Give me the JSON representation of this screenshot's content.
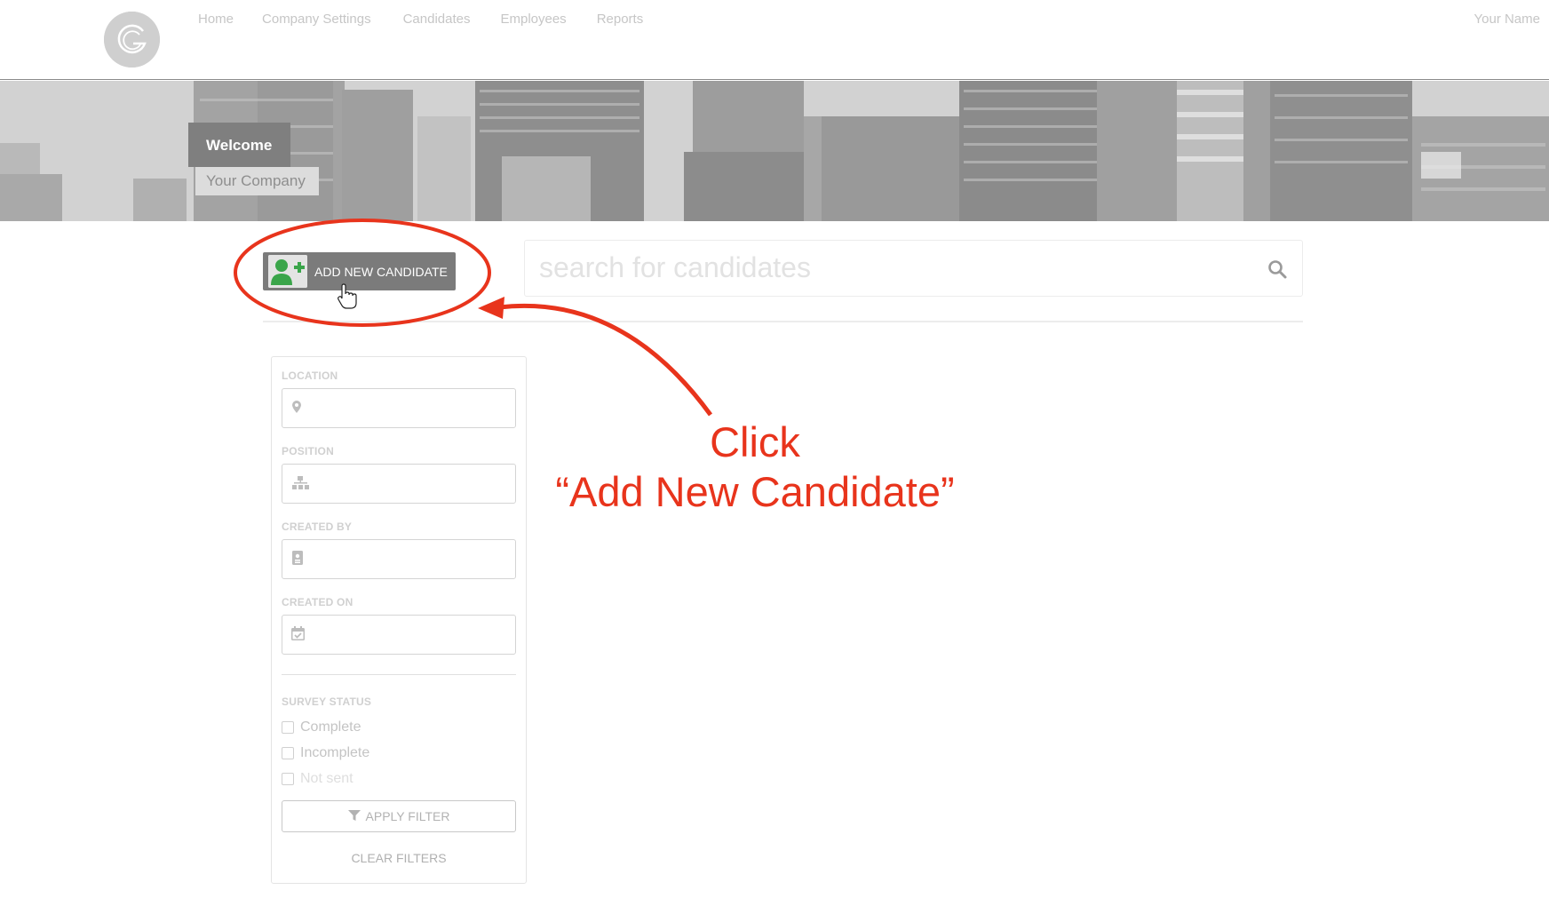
{
  "nav": {
    "items": [
      "Home",
      "Company Settings",
      "Candidates",
      "Employees",
      "Reports"
    ],
    "user_name": "Your Name"
  },
  "banner": {
    "welcome": "Welcome",
    "company": "Your Company"
  },
  "actions": {
    "add_candidate_label": "ADD NEW CANDIDATE",
    "search_placeholder": "search for candidates"
  },
  "filters": {
    "location_label": "LOCATION",
    "position_label": "POSITION",
    "created_by_label": "CREATED BY",
    "created_on_label": "CREATED ON",
    "survey_status_label": "SURVEY STATUS",
    "survey_options": [
      "Complete",
      "Incomplete",
      "Not sent"
    ],
    "apply_label": "APPLY FILTER",
    "clear_label": "CLEAR FILTERS"
  },
  "annotation": {
    "line1": "Click",
    "line2": "“Add New Candidate”",
    "color": "#e8341c"
  },
  "icons": {
    "logo": "g-logo-icon",
    "add_candidate": "add-user-icon",
    "search": "search-icon",
    "location": "map-pin-icon",
    "position": "org-chart-icon",
    "created_by": "id-badge-icon",
    "created_on": "calendar-check-icon",
    "apply": "filter-icon",
    "cursor": "hand-pointer-icon"
  }
}
